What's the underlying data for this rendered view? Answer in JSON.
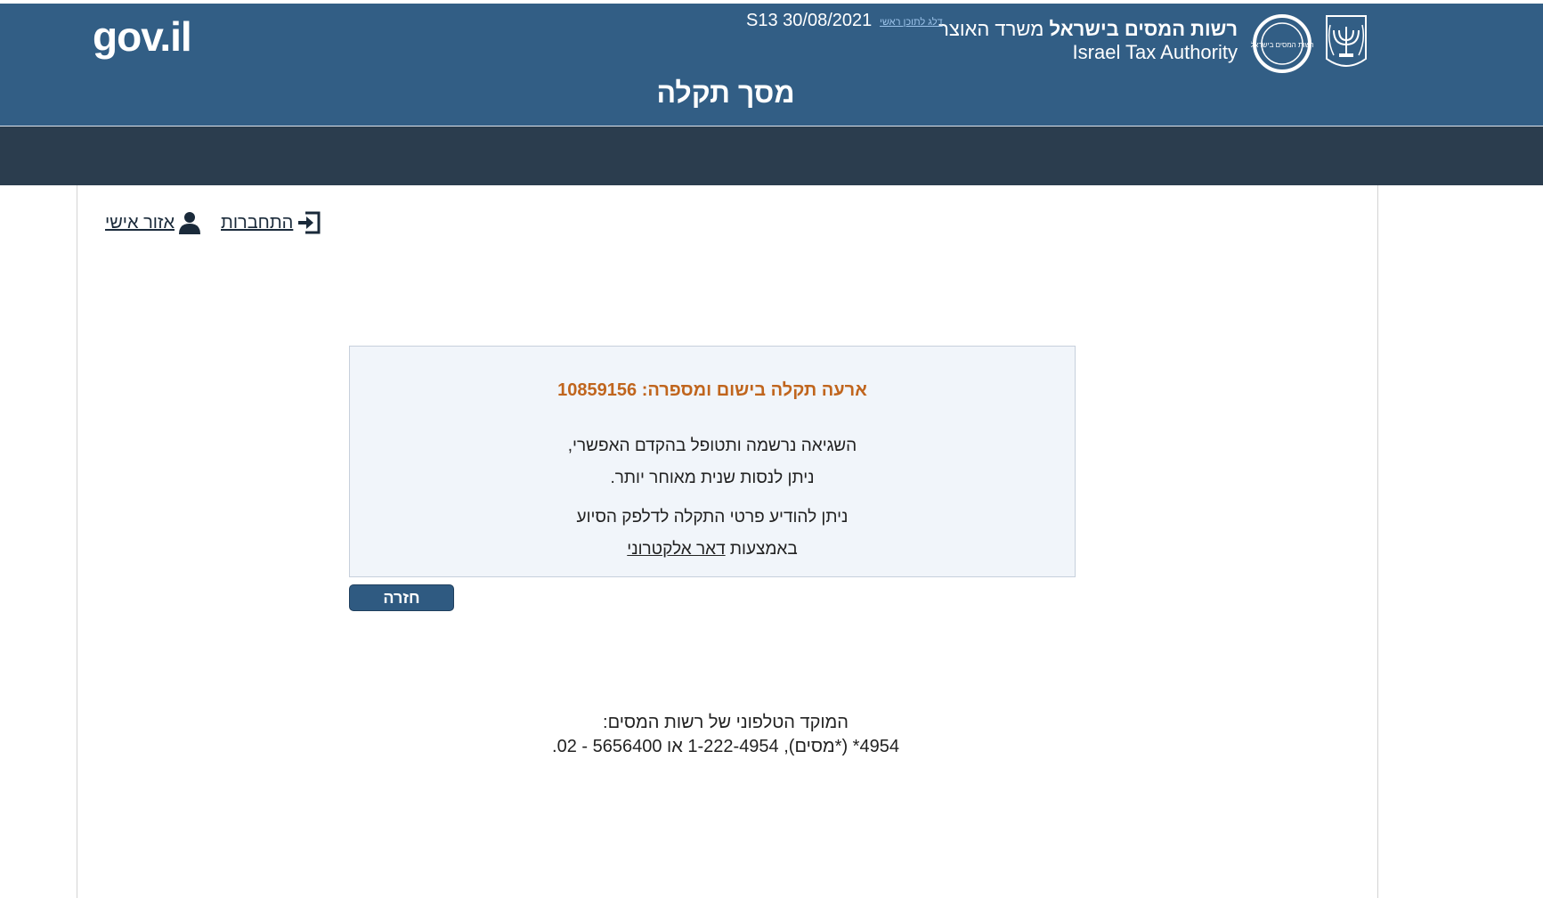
{
  "header": {
    "ita_name_bold": "רשות המסים בישראל",
    "ita_ministry": "משרד האוצר",
    "ita_name_en": "Israel Tax Authority",
    "ita_logo_text": "רשות המסים בישראל",
    "skip_link": "דלג לתוכן ראשי",
    "build_info": "S13 30/08/2021",
    "gov_logo": "gov.il",
    "page_title": "מסך תקלה"
  },
  "user_links": {
    "login_label": "התחברות",
    "personal_area_label": "אזור אישי"
  },
  "message": {
    "title_prefix": "ארעה תקלה בישום ומספרה:",
    "incident_number": "10859156",
    "line1": "השגיאה נרשמה ותטופל בהקדם האפשרי,",
    "line2": "ניתן לנסות שנית מאוחר יותר.",
    "line3": "ניתן להודיע פרטי התקלה לדלפק הסיוע",
    "line4_prefix": "באמצעות",
    "email_link": "דאר אלקטרוני"
  },
  "back_button_label": "חזרה",
  "support": {
    "title": "המוקד הטלפוני של רשות המסים:",
    "phones": "4954* (*מסים), 1-222-4954 או 5656400 - 02."
  },
  "colors": {
    "header_bg": "#325e85",
    "navbar_bg": "#2b3d4e",
    "title_orange": "#c0651d",
    "button_bg": "#2f5a81"
  }
}
